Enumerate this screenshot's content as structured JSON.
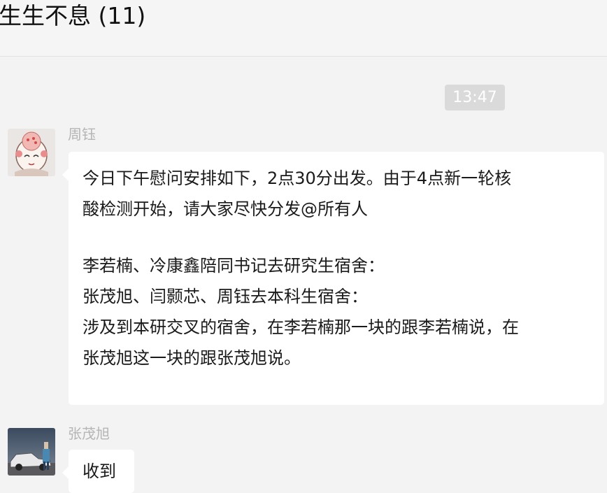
{
  "header": {
    "title": "生生不息 (11)"
  },
  "messages": {
    "timestamp": "13:47",
    "first": {
      "sender": "周钰",
      "avatar_icon": "cartoon-face-avatar",
      "lines": [
        "今日下午慰问安排如下，2点30分出发。由于4点新一轮核",
        "酸检测开始，请大家尽快分发@所有人",
        "李若楠、冷康鑫陪同书记去研究生宿舍：",
        "张茂旭、闫颢芯、周钰去本科生宿舍：",
        "涉及到本研交叉的宿舍，在李若楠那一块的跟李若楠说，在",
        "张茂旭这一块的跟张茂旭说。"
      ]
    },
    "second": {
      "sender": "张茂旭",
      "avatar_icon": "person-with-car-photo-avatar",
      "text": "收到"
    }
  }
}
